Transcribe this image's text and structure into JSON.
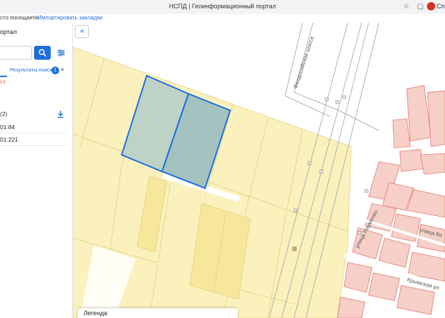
{
  "browser": {
    "title": "НСПД | Геоинформационный портал",
    "profile_text": "Сп"
  },
  "bookmarks": {
    "item1": "сто посещаете.",
    "item2": "Импортировать закладки"
  },
  "panel": {
    "title": "ортал",
    "tab_label": "Результаты поиска",
    "tab_badge": "1",
    "tab_close": "×",
    "red_text": "1/1",
    "count_label": "(2)",
    "rows": [
      "01:84",
      "01:221"
    ]
  },
  "map": {
    "collapse_label": "«",
    "legend_label": "Легенда",
    "streets": {
      "highway": "Феодосийское шоссе",
      "naumenko": "улица Науменко",
      "right_street": "улица Ко",
      "krymskaya": "Крымская ул"
    }
  },
  "colors": {
    "accent": "#1f6fdb",
    "parcel_fill": "#fbf1bd",
    "parcel_stroke": "#e9d88a",
    "selected_fill": "#9fbfbf",
    "selected_stroke": "#1a6fe0",
    "building_fill": "#f6cfc8",
    "building_stroke": "#e07a6c"
  },
  "icons": [
    "search-icon",
    "filter-icon",
    "close-icon",
    "download-icon",
    "collapse-icon",
    "star-icon",
    "extension-icon"
  ]
}
